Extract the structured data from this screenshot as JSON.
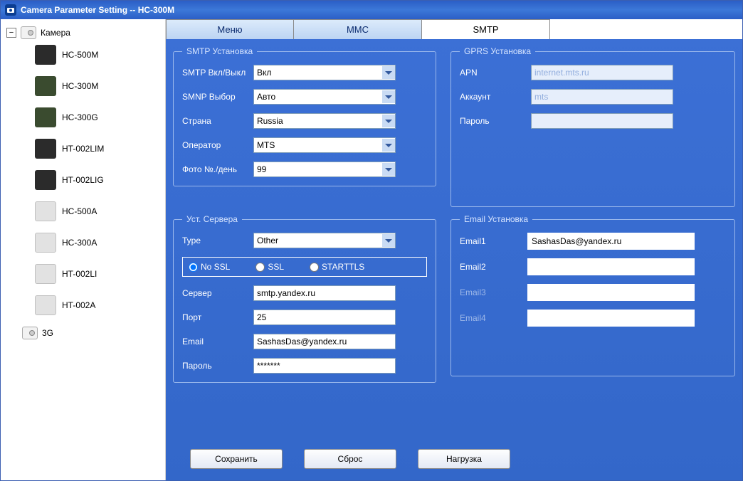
{
  "titlebar": {
    "title": "Camera Parameter Setting -- HC-300M"
  },
  "sidebar": {
    "root": {
      "label": "Камера",
      "toggle": "−"
    },
    "items": [
      {
        "label": "HC-500M",
        "iconClass": "dev-dark"
      },
      {
        "label": "HC-300M",
        "iconClass": "dev-green"
      },
      {
        "label": "HC-300G",
        "iconClass": "dev-green"
      },
      {
        "label": "HT-002LIM",
        "iconClass": "dev-dark"
      },
      {
        "label": "HT-002LIG",
        "iconClass": "dev-dark"
      },
      {
        "label": "HC-500A",
        "iconClass": "dev-grey"
      },
      {
        "label": "HC-300A",
        "iconClass": "dev-grey"
      },
      {
        "label": "HT-002LI",
        "iconClass": "dev-grey"
      },
      {
        "label": "HT-002A",
        "iconClass": "dev-grey"
      }
    ],
    "extra": {
      "label": "3G"
    }
  },
  "tabs": [
    {
      "label": "Меню",
      "active": false
    },
    {
      "label": "MMC",
      "active": false
    },
    {
      "label": "SMTP",
      "active": true
    }
  ],
  "smtp": {
    "legend": "SMTP Установка",
    "rows": {
      "enable": {
        "label": "SMTP Вкл/Выкл",
        "value": "Вкл"
      },
      "smnp": {
        "label": "SMNP Выбор",
        "value": "Авто"
      },
      "country": {
        "label": "Страна",
        "value": "Russia"
      },
      "operator": {
        "label": "Оператор",
        "value": "MTS"
      },
      "photos": {
        "label": "Фото №./день",
        "value": "99"
      }
    }
  },
  "gprs": {
    "legend": "GPRS Установка",
    "rows": {
      "apn": {
        "label": "APN",
        "value": "internet.mts.ru"
      },
      "account": {
        "label": "Аккаунт",
        "value": "mts"
      },
      "password": {
        "label": "Пароль",
        "value": ""
      }
    }
  },
  "server": {
    "legend": "Уст. Сервера",
    "type": {
      "label": "Type",
      "value": "Other"
    },
    "ssl": {
      "options": [
        "No SSL",
        "SSL",
        "STARTTLS"
      ],
      "selected": "No SSL"
    },
    "rows": {
      "server": {
        "label": "Сервер",
        "value": "smtp.yandex.ru"
      },
      "port": {
        "label": "Порт",
        "value": "25"
      },
      "email": {
        "label": "Email",
        "value": "SashasDas@yandex.ru"
      },
      "password": {
        "label": "Пароль",
        "value": "*******"
      }
    }
  },
  "email": {
    "legend": "Email Установка",
    "rows": {
      "e1": {
        "label": "Email1",
        "value": "SashasDas@yandex.ru",
        "dim": false
      },
      "e2": {
        "label": "Email2",
        "value": "",
        "dim": false
      },
      "e3": {
        "label": "Email3",
        "value": "",
        "dim": true
      },
      "e4": {
        "label": "Email4",
        "value": "",
        "dim": true
      }
    }
  },
  "buttons": {
    "save": "Сохранить",
    "reset": "Сброс",
    "load": "Нагрузка"
  }
}
